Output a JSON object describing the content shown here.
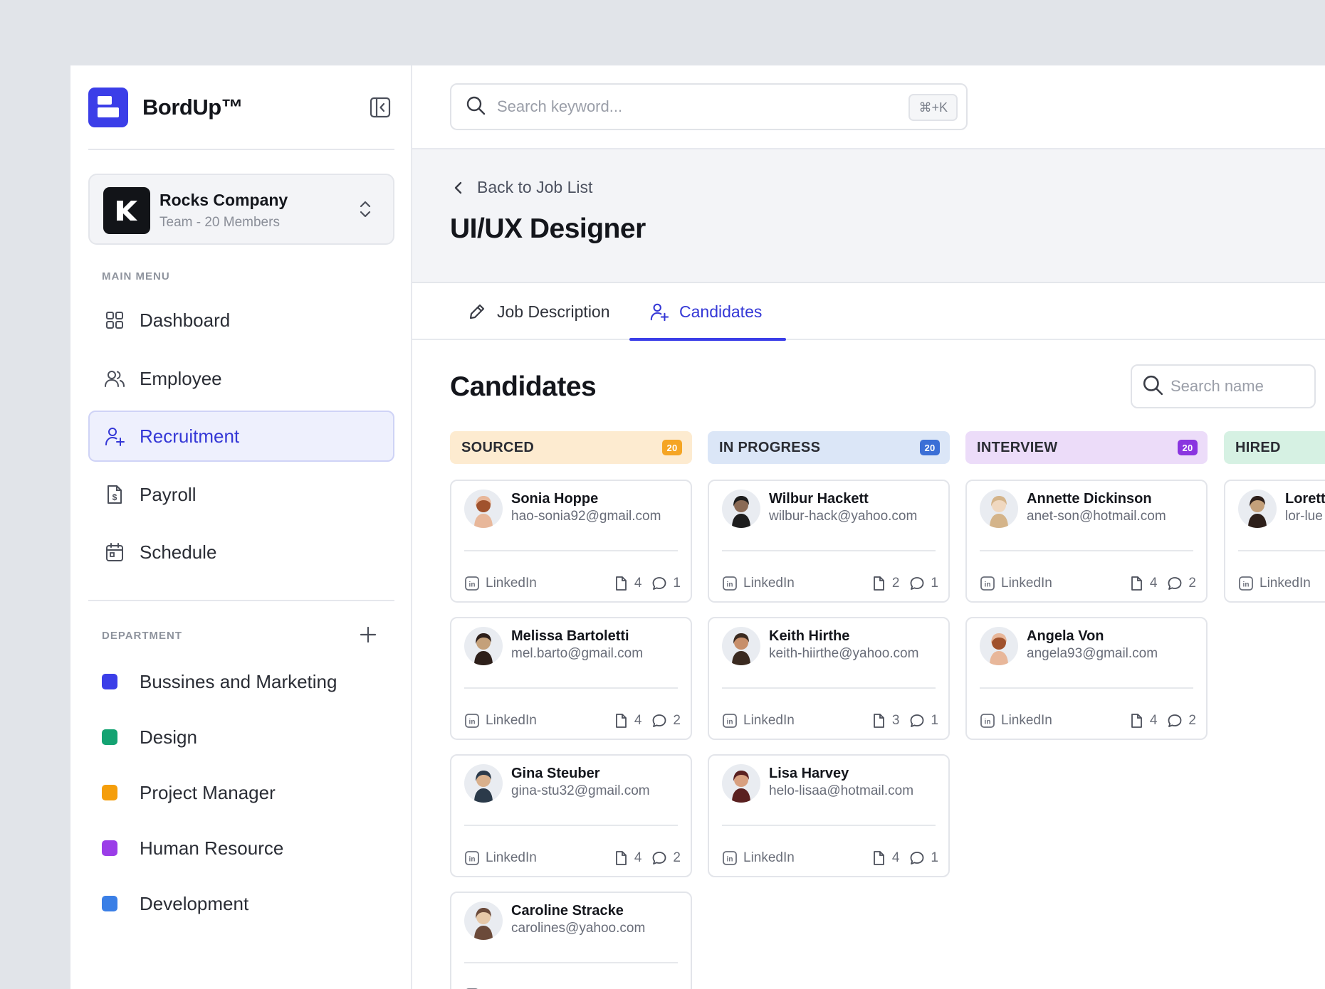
{
  "brand": {
    "name": "BordUp™"
  },
  "company": {
    "name": "Rocks Company",
    "subtitle": "Team - 20 Members"
  },
  "sidebar": {
    "main_menu_label": "MAIN MENU",
    "items": [
      {
        "label": "Dashboard",
        "icon": "grid-icon"
      },
      {
        "label": "Employee",
        "icon": "users-icon"
      },
      {
        "label": "Recruitment",
        "icon": "user-plus-icon",
        "active": true
      },
      {
        "label": "Payroll",
        "icon": "dollar-file-icon"
      },
      {
        "label": "Schedule",
        "icon": "calendar-icon"
      }
    ],
    "department_label": "DEPARTMENT",
    "departments": [
      {
        "label": "Bussines and Marketing",
        "color": "#3b3ee8"
      },
      {
        "label": "Design",
        "color": "#14a372"
      },
      {
        "label": "Project Manager",
        "color": "#f59e0b"
      },
      {
        "label": "Human Resource",
        "color": "#9b3de8"
      },
      {
        "label": "Development",
        "color": "#3a7fe6"
      }
    ]
  },
  "search": {
    "placeholder": "Search keyword...",
    "shortcut": "⌘+K"
  },
  "header": {
    "back_label": "Back to Job List",
    "job_title": "UI/UX Designer"
  },
  "tabs": [
    {
      "label": "Job Description",
      "icon": "pencil-icon"
    },
    {
      "label": "Candidates",
      "icon": "user-plus-icon",
      "active": true
    }
  ],
  "candidates": {
    "title": "Candidates",
    "search_placeholder": "Search name"
  },
  "columns": [
    {
      "title": "SOURCED",
      "count": "20",
      "bg": "#fdebd0",
      "badge": "#f5a524",
      "cards": [
        {
          "name": "Sonia Hoppe",
          "email": "hao-sonia92@gmail.com",
          "link": "LinkedIn",
          "files": "4",
          "comments": "1"
        },
        {
          "name": "Melissa Bartoletti",
          "email": "mel.barto@gmail.com",
          "link": "LinkedIn",
          "files": "4",
          "comments": "2"
        },
        {
          "name": "Gina Steuber",
          "email": "gina-stu32@gmail.com",
          "link": "LinkedIn",
          "files": "4",
          "comments": "2"
        },
        {
          "name": "Caroline Stracke",
          "email": "carolines@yahoo.com",
          "link": "LinkedIn",
          "files": "",
          "comments": ""
        }
      ]
    },
    {
      "title": "IN PROGRESS",
      "count": "20",
      "bg": "#dbe6f7",
      "badge": "#3b6fd6",
      "cards": [
        {
          "name": "Wilbur Hackett",
          "email": "wilbur-hack@yahoo.com",
          "link": "LinkedIn",
          "files": "2",
          "comments": "1"
        },
        {
          "name": "Keith Hirthe",
          "email": "keith-hiirthe@yahoo.com",
          "link": "LinkedIn",
          "files": "3",
          "comments": "1"
        },
        {
          "name": "Lisa Harvey",
          "email": "helo-lisaa@hotmail.com",
          "link": "LinkedIn",
          "files": "4",
          "comments": "1"
        }
      ]
    },
    {
      "title": "INTERVIEW",
      "count": "20",
      "bg": "#ecdcf9",
      "badge": "#8a35e0",
      "cards": [
        {
          "name": "Annette Dickinson",
          "email": "anet-son@hotmail.com",
          "link": "LinkedIn",
          "files": "4",
          "comments": "2"
        },
        {
          "name": "Angela Von",
          "email": "angela93@gmail.com",
          "link": "LinkedIn",
          "files": "4",
          "comments": "2"
        }
      ]
    },
    {
      "title": "HIRED",
      "count": "",
      "bg": "#d6f1e3",
      "badge": "#14a372",
      "cards": [
        {
          "name": "Loretta",
          "email": "lor-lue",
          "link": "LinkedIn",
          "files": "",
          "comments": ""
        }
      ]
    }
  ]
}
